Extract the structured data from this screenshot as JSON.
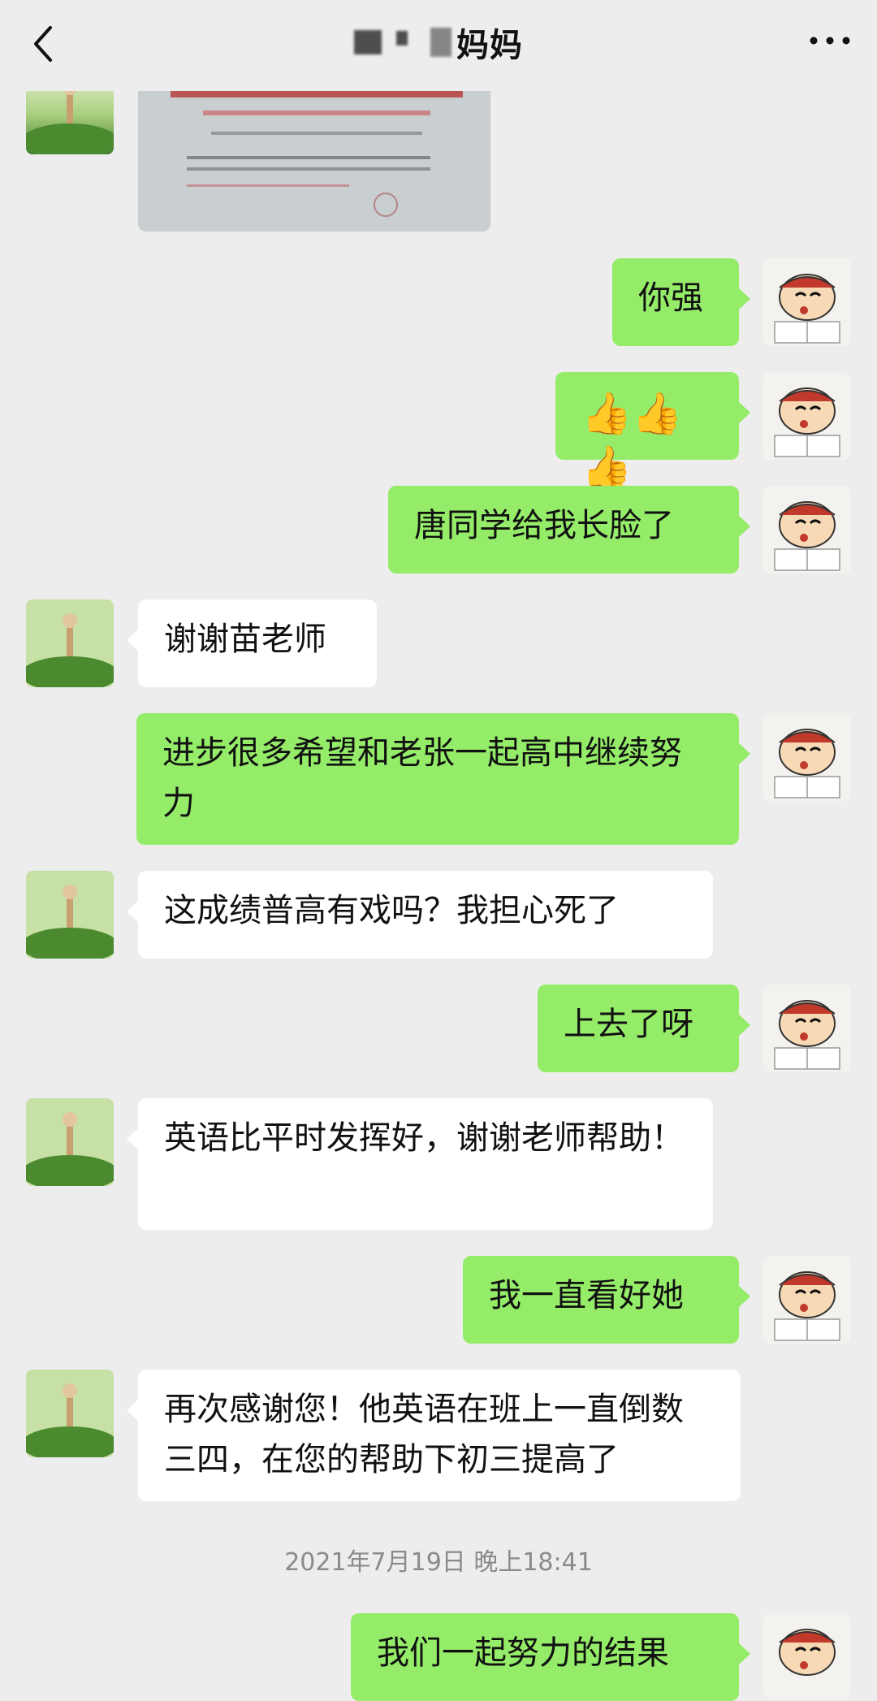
{
  "header": {
    "title_suffix": "妈妈",
    "back_icon": "chevron-left-icon",
    "more_icon": "more-dots-icon"
  },
  "messages": [
    {
      "side": "right",
      "text": "你强"
    },
    {
      "side": "right",
      "text": "👍👍👍"
    },
    {
      "side": "right",
      "text": "唐同学给我长脸了"
    },
    {
      "side": "left",
      "text": "谢谢苗老师"
    },
    {
      "side": "right",
      "text": "进步很多希望和老张一起高中继续努力"
    },
    {
      "side": "left",
      "text": "这成绩普高有戏吗？我担心死了"
    },
    {
      "side": "right",
      "text": "上去了呀"
    },
    {
      "side": "left",
      "text": "英语比平时发挥好，谢谢老师帮助！"
    },
    {
      "side": "right",
      "text": "我一直看好她"
    },
    {
      "side": "left",
      "text": "再次感谢您！他英语在班上一直倒数三四，在您的帮助下初三提高了"
    },
    {
      "side": "right",
      "text": "我们一起努力的结果"
    }
  ],
  "timestamp": "2021年7月19日 晚上18:41",
  "colors": {
    "background": "#ededed",
    "self_bubble": "#95ec69",
    "other_bubble": "#ffffff"
  }
}
